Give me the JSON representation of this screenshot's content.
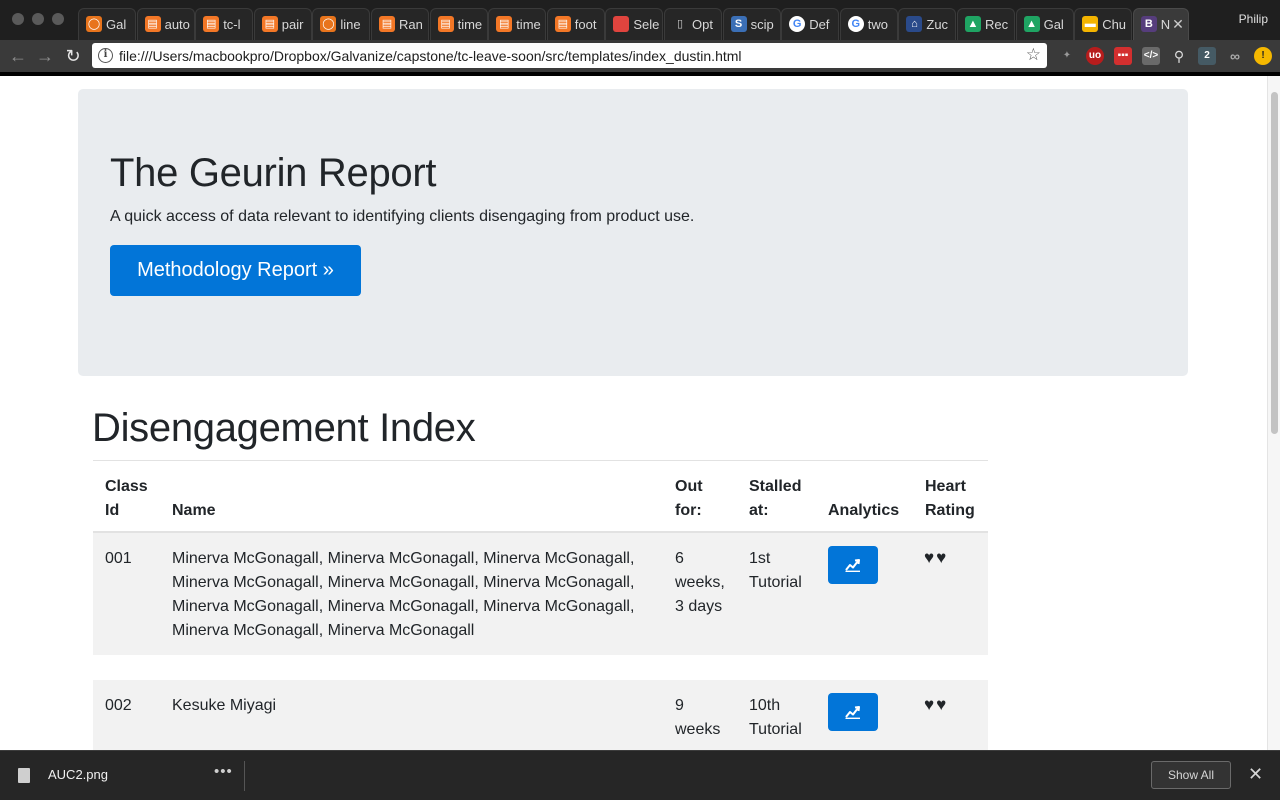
{
  "browser": {
    "tabs": [
      {
        "title": "Gal",
        "icon": "galvanize-icon",
        "color": "#e8741c"
      },
      {
        "title": "auto",
        "icon": "notebook-icon",
        "color": "#f37726"
      },
      {
        "title": "tc-l",
        "icon": "notebook-icon",
        "color": "#f37726"
      },
      {
        "title": "pair",
        "icon": "notebook-icon",
        "color": "#f37726"
      },
      {
        "title": "line",
        "icon": "galvanize-icon",
        "color": "#e8741c"
      },
      {
        "title": "Ran",
        "icon": "notebook-icon",
        "color": "#f37726"
      },
      {
        "title": "time",
        "icon": "notebook-icon",
        "color": "#f37726"
      },
      {
        "title": "time",
        "icon": "notebook-icon",
        "color": "#f37726"
      },
      {
        "title": "foot",
        "icon": "notebook-icon",
        "color": "#f37726"
      },
      {
        "title": "Sele",
        "icon": "red-square-icon",
        "color": "#e0443e"
      },
      {
        "title": "Opt",
        "icon": "document-icon",
        "color": "#9a9a9a"
      },
      {
        "title": "scip",
        "icon": "scipy-icon",
        "color": "#3b6fb6"
      },
      {
        "title": "Def",
        "icon": "google-icon",
        "color": "#4285f4"
      },
      {
        "title": "two",
        "icon": "google-icon",
        "color": "#4285f4"
      },
      {
        "title": "Zuc",
        "icon": "house-icon",
        "color": "#2a4a8a"
      },
      {
        "title": "Rec",
        "icon": "drive-icon",
        "color": "#1fa463"
      },
      {
        "title": "Gal",
        "icon": "drive-icon",
        "color": "#1fa463"
      },
      {
        "title": "Chu",
        "icon": "slides-icon",
        "color": "#f4b400"
      },
      {
        "title": "N",
        "icon": "bootstrap-icon",
        "color": "#563d7c"
      }
    ],
    "profile_name": "Philip",
    "url": "file:///Users/macbookpro/Dropbox/Galvanize/capstone/tc-leave-soon/src/templates/index_dustin.html"
  },
  "jumbotron": {
    "title": "The Geurin Report",
    "lead": "A quick access of data relevant to identifying clients disengaging from product use.",
    "button_label": "Methodology Report »"
  },
  "section_title": "Disengagement Index",
  "table": {
    "headers": {
      "class_id": [
        "Class",
        "Id"
      ],
      "name": "Name",
      "out_for": [
        "Out",
        "for:"
      ],
      "stalled_at": [
        "Stalled",
        "at:"
      ],
      "analytics": "Analytics",
      "heart_rating": [
        "Heart",
        "Rating"
      ]
    },
    "rows": [
      {
        "class_id": "001",
        "name_lines": [
          "Minerva McGonagall, Minerva McGonagall, Minerva McGonagall,",
          "Minerva McGonagall, Minerva McGonagall, Minerva McGonagall,",
          "Minerva McGonagall, Minerva McGonagall, Minerva McGonagall,",
          "Minerva McGonagall, Minerva McGonagall"
        ],
        "out_for_lines": [
          "6",
          "weeks,",
          "3 days"
        ],
        "stalled_at_lines": [
          "1st",
          "Tutorial"
        ],
        "analytics_icon": "chart-line-icon",
        "hearts": "♥♥"
      },
      {
        "class_id": "002",
        "name_lines": [
          "Kesuke Miyagi"
        ],
        "out_for_lines": [
          "9",
          "weeks"
        ],
        "stalled_at_lines": [
          "10th",
          "Tutorial"
        ],
        "analytics_icon": "chart-line-icon",
        "hearts": "♥♥"
      }
    ]
  },
  "download_shelf": {
    "file_name": "AUC2.png",
    "more_label": "•••",
    "show_all_label": "Show All",
    "close_label": "✕"
  },
  "colors": {
    "primary": "#0275d8",
    "jumbotron_bg": "#e9ecef",
    "row_bg": "#f2f2f2"
  }
}
